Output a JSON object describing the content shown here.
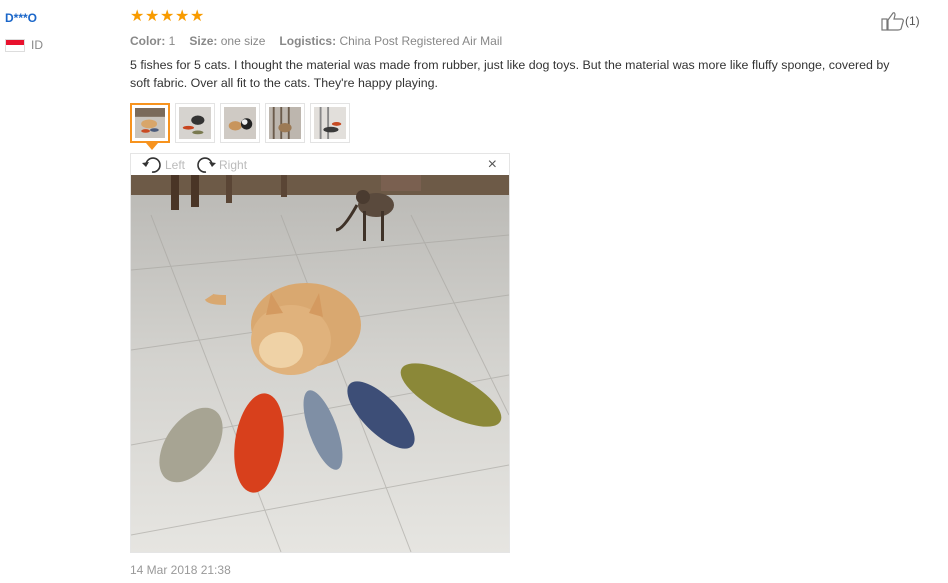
{
  "user": {
    "name": "D***O",
    "country": "ID"
  },
  "review": {
    "rating": 5,
    "color_label": "Color:",
    "color_value": "1",
    "size_label": "Size:",
    "size_value": "one size",
    "logistics_label": "Logistics:",
    "logistics_value": "China Post Registered Air Mail",
    "text": "5 fishes for 5 cats. I thought the material was made from rubber, just like dog toys. But the material was more like fluffy sponge, covered by soft fabric. Over all fit to the cats. They're happy playing.",
    "date": "14 Mar 2018 21:38",
    "likes": "(1)"
  },
  "viewer": {
    "left_label": "Left",
    "right_label": "Right",
    "close_label": "×",
    "thumbnail_count": 5,
    "active_thumbnail": 1
  },
  "colors": {
    "star": "#f89b00",
    "username": "#1a66c9",
    "active_border": "#f7931e"
  }
}
